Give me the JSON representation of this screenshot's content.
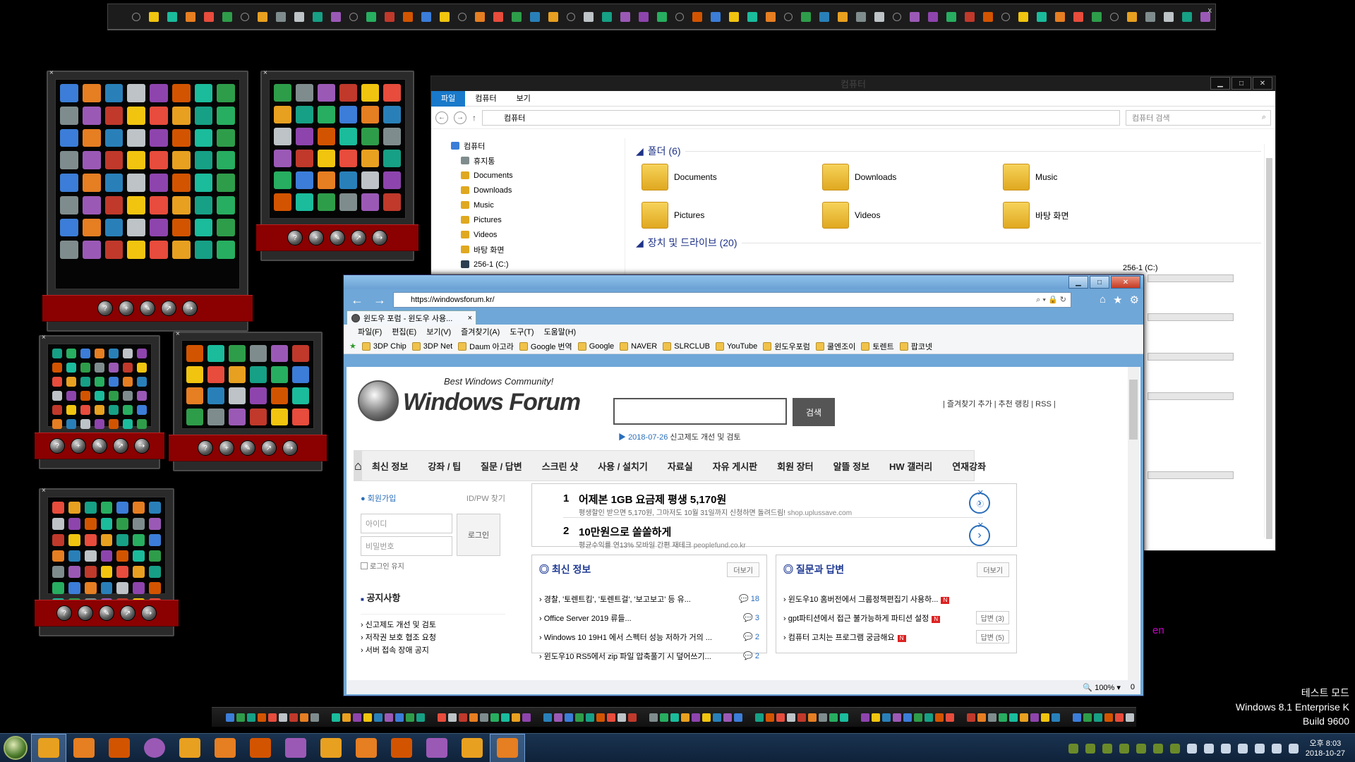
{
  "top_launcher": {
    "close": "x",
    "icon_count": 64
  },
  "explorer": {
    "title": "컴퓨터",
    "ribbon_tabs": [
      "파일",
      "컴퓨터",
      "보기"
    ],
    "address": "컴퓨터",
    "search_placeholder": "컴퓨터 검색",
    "tree": [
      "컴퓨터",
      "휴지통",
      "Documents",
      "Downloads",
      "Music",
      "Pictures",
      "Videos",
      "바탕 화면",
      "256-1 (C:)"
    ],
    "folders_header": "폴더 (6)",
    "folders": [
      "Documents",
      "Downloads",
      "Music",
      "Pictures",
      "Videos",
      "바탕 화면"
    ],
    "drives_header": "장치 및 드라이브 (20)",
    "drive_label": "256-1 (C:)"
  },
  "ie": {
    "url": "https://windowsforum.kr/",
    "tab_title": "윈도우 포럼 - 윈도우 사용...",
    "tab_close": "×",
    "menu": [
      "파일(F)",
      "편집(E)",
      "보기(V)",
      "즐겨찾기(A)",
      "도구(T)",
      "도움말(H)"
    ],
    "favorites": [
      "3DP Chip",
      "3DP Net",
      "Daum 아고라",
      "Google 번역",
      "Google",
      "NAVER",
      "SLRCLUB",
      "YouTube",
      "윈도우포럼",
      "쿨엔조이",
      "토렌트",
      "팝코넷"
    ],
    "zoom": "100%",
    "status_count": "0"
  },
  "site": {
    "tagline": "Best Windows Community!",
    "logo_name": "Windows Forum",
    "search_btn": "검색",
    "top_links": "| 즐겨찾기 추가 | 추천 랭킹 | RSS |",
    "news_date": "2018-07-26",
    "news_text": "신고제도 개선 및 검토",
    "nav": [
      "최신 정보",
      "강좌 / 팁",
      "질문 / 답변",
      "스크린 샷",
      "사용 / 설치기",
      "자료실",
      "자유 게시판",
      "회원 장터",
      "알뜰 정보",
      "HW 갤러리",
      "연재강좌"
    ],
    "signup": "회원가입",
    "find_id": "ID/PW 찾기",
    "id_placeholder": "아이디",
    "pw_placeholder": "비밀번호",
    "login_btn": "로그인",
    "keep_login": "로그인 유지",
    "notice_title": "공지사항",
    "notices": [
      "신고제도 개선 및 검토",
      "저작권 보호 협조 요청",
      "서버 접속 장애 공지"
    ],
    "ads": [
      {
        "num": "1",
        "headline": "어제본 1GB 요금제 평생 5,170원",
        "sub": "평생할인 받으면 5,170원, 그마저도 10월 31일까지 신청하면 돌려드림!",
        "url": "shop.uplussave.com"
      },
      {
        "num": "2",
        "headline": "10만원으로 쏠쏠하게",
        "sub": "평균수익률 연13% 모바일 간편 재테크",
        "url": "peoplefund.co.kr"
      }
    ],
    "latest": {
      "title": "최신 정보",
      "more": "더보기",
      "items": [
        {
          "text": "경찰, '토렌트킴', '토렌트걸', '보고보고' 등 유...",
          "count": "18"
        },
        {
          "text": "Office Server 2019 류들...",
          "count": "3"
        },
        {
          "text": "Windows 10 19H1 에서 스펙터 성능 저하가 거의 ...",
          "count": "2"
        },
        {
          "text": "윈도우10 RS5에서 zip 파일 압축풀기 시 덮어쓰기...",
          "count": "2"
        }
      ]
    },
    "qna": {
      "title": "질문과 답변",
      "more": "더보기",
      "items": [
        {
          "text": "윈도우10 홈버전에서 그룹정책편집기 사용하...",
          "tag": ""
        },
        {
          "text": "gpt파티션에서 접근 불가능하게 파티션 설정",
          "tag": "답변 (3)"
        },
        {
          "text": "컴퓨터 고치는 프로그램 궁금해요",
          "tag": "답변 (5)"
        }
      ]
    }
  },
  "ime": "en",
  "watermark": {
    "line1": "테스트 모드",
    "line2": "Windows 8.1 Enterprise K",
    "line3": "Build 9600"
  },
  "clock": {
    "time": "오후 8:03",
    "date": "2018-10-27"
  },
  "colors": {
    "panel_red": "#8b0000",
    "ie_frame": "#6fa7d8",
    "ribbon_blue": "#1979ca",
    "taskbar": "#0f223a"
  }
}
